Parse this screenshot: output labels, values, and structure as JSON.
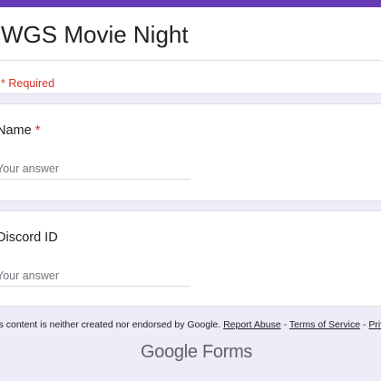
{
  "form": {
    "title": "WGS Movie Night",
    "required_note": "* Required"
  },
  "questions": [
    {
      "label": "Name",
      "required": true,
      "required_marker": "*",
      "placeholder": "Your answer",
      "value": ""
    },
    {
      "label": "Discord ID",
      "required": false,
      "placeholder": "Your answer",
      "value": ""
    }
  ],
  "footer": {
    "disclaimer": "This content is neither created nor endorsed by Google.",
    "sep": "-",
    "links": {
      "report_abuse": "Report Abuse",
      "terms": "Terms of Service",
      "privacy": "Privacy Policy"
    }
  },
  "logo": {
    "brand": "Google",
    "product": "Forms"
  },
  "colors": {
    "accent": "#673ab7",
    "page_bg": "#f0ebf8",
    "required_red": "#d93025"
  }
}
